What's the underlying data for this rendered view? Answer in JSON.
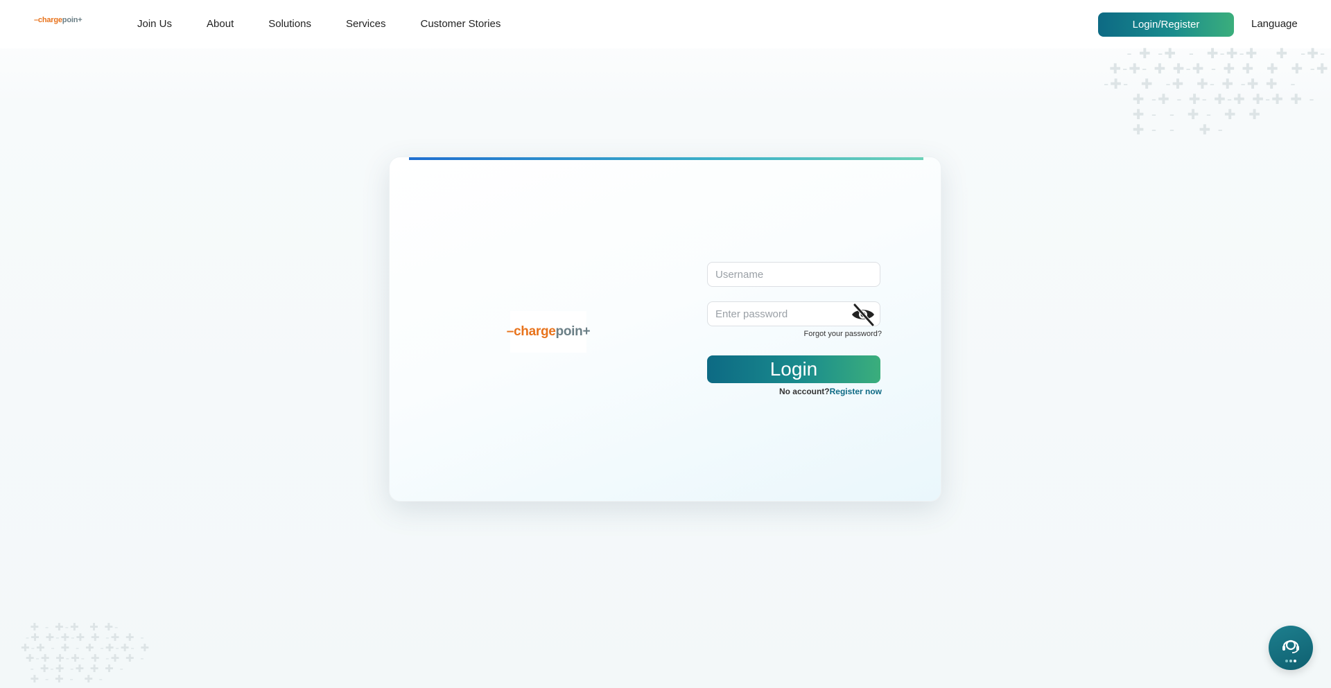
{
  "header": {
    "logo": {
      "dash": "–",
      "charge": "charge",
      "point": "poin+"
    },
    "nav": [
      {
        "label": "Join Us"
      },
      {
        "label": "About"
      },
      {
        "label": "Solutions"
      },
      {
        "label": "Services"
      },
      {
        "label": "Customer Stories"
      }
    ],
    "login_register_label": "Login/Register",
    "language_label": "Language"
  },
  "card": {
    "logo": {
      "dash": "–",
      "charge": "charge",
      "point": "poin+"
    },
    "username": {
      "placeholder": "Username",
      "value": ""
    },
    "password": {
      "placeholder": "Enter password",
      "value": "",
      "toggle_icon": "eye-slash-icon"
    },
    "forgot_label": "Forgot your password?",
    "login_label": "Login",
    "no_account_label": "No account?",
    "register_now_label": "Register now"
  },
  "chat": {
    "icon": "customer-support-icon"
  },
  "colors": {
    "brand_orange": "#e8731c",
    "brand_gray": "#6b7f86",
    "accent_teal": "#0d6a84",
    "accent_green": "#3bae7c"
  }
}
